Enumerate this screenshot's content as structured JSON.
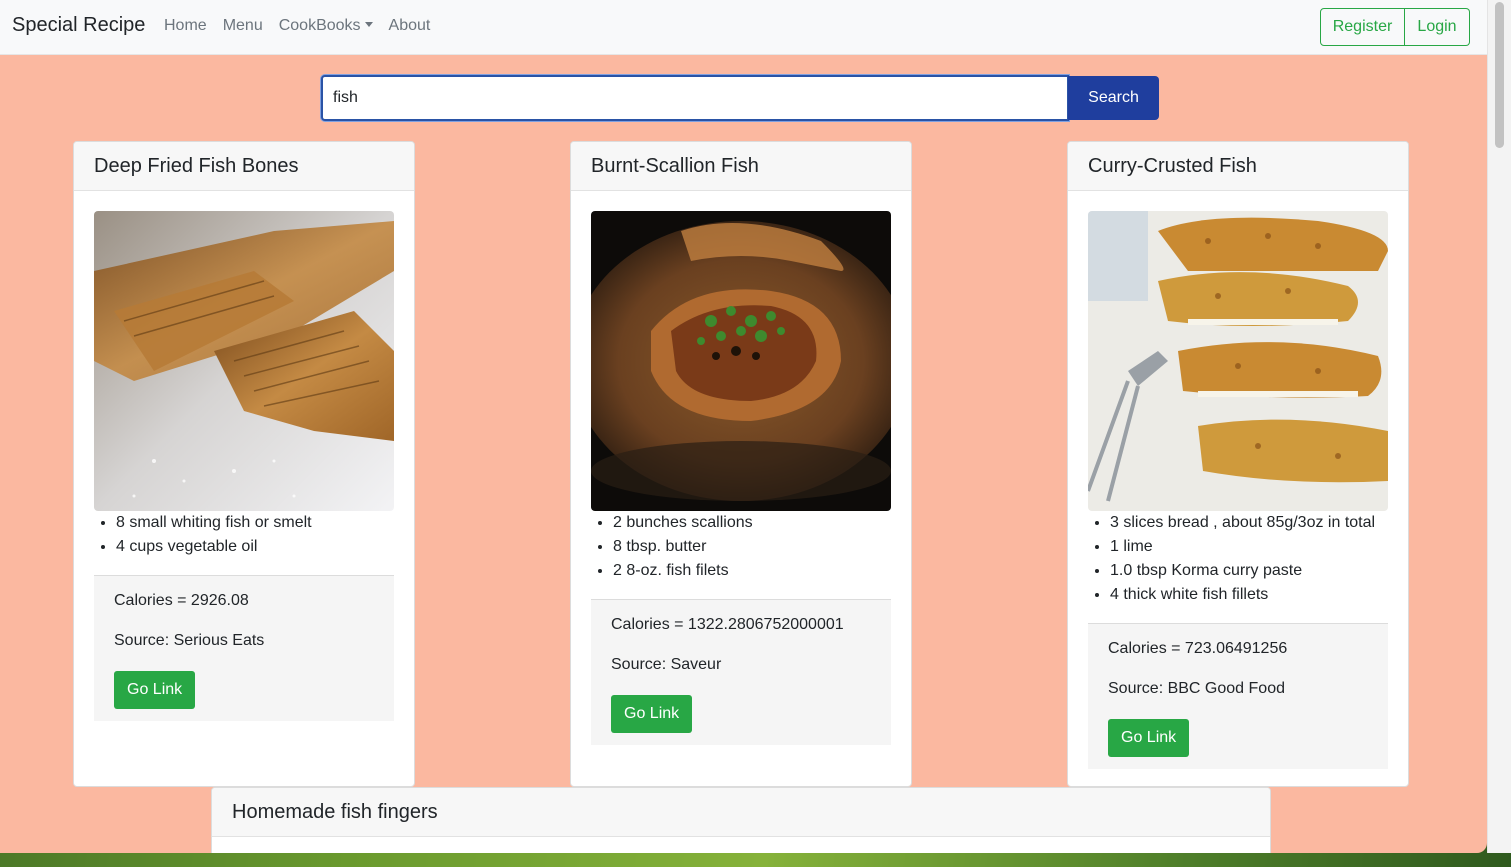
{
  "navbar": {
    "brand": "Special Recipe",
    "links": [
      "Home",
      "Menu",
      "CookBooks",
      "About"
    ],
    "register": "Register",
    "login": "Login"
  },
  "search": {
    "value": "fish",
    "button": "Search"
  },
  "cards": [
    {
      "title": "Deep Fried Fish Bones",
      "ingredients": [
        "8 small whiting fish or smelt",
        "4 cups vegetable oil"
      ],
      "calories": "Calories = 2926.08",
      "source": "Source: Serious Eats",
      "button": "Go Link",
      "image_icon": "fried-fish-bones-photo"
    },
    {
      "title": "Burnt-Scallion Fish",
      "ingredients": [
        "2 bunches scallions",
        "8 tbsp. butter",
        "2 8-oz. fish filets"
      ],
      "calories": "Calories = 1322.2806752000001",
      "source": "Source: Saveur",
      "button": "Go Link",
      "image_icon": "scallion-fish-photo"
    },
    {
      "title": "Curry-Crusted Fish",
      "ingredients": [
        "3 slices bread , about 85g/3oz in total",
        "1 lime",
        "1.0 tbsp Korma curry paste",
        "4 thick white fish fillets"
      ],
      "calories": "Calories = 723.06491256",
      "source": "Source: BBC Good Food",
      "button": "Go Link",
      "image_icon": "curry-crusted-fish-photo"
    },
    {
      "title": "Homemade fish fingers"
    }
  ],
  "colors": {
    "background": "#fbb8a0",
    "accent_green": "#28a745",
    "search_blue": "#1f3e9e"
  }
}
